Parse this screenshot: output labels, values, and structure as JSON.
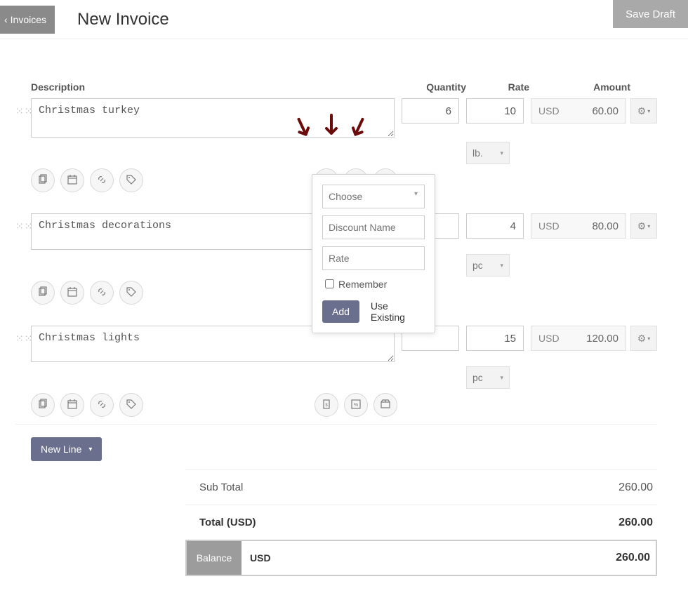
{
  "header": {
    "back_label": "Invoices",
    "title": "New Invoice",
    "save_draft_label": "Save Draft"
  },
  "columns": {
    "description": "Description",
    "quantity": "Quantity",
    "rate": "Rate",
    "amount": "Amount"
  },
  "lines": [
    {
      "description": "Christmas turkey",
      "quantity": "6",
      "rate": "10",
      "unit": "lb.",
      "currency": "USD",
      "amount": "60.00"
    },
    {
      "description": "Christmas decorations",
      "quantity": "",
      "rate": "4",
      "unit": "pc",
      "currency": "USD",
      "amount": "80.00"
    },
    {
      "description": "Christmas lights",
      "quantity": "",
      "rate": "15",
      "unit": "pc",
      "currency": "USD",
      "amount": "120.00"
    }
  ],
  "new_line_label": "New Line",
  "totals": {
    "subtotal_label": "Sub Total",
    "subtotal_value": "260.00",
    "total_label": "Total (USD)",
    "total_value": "260.00",
    "balance_label": "Balance",
    "balance_currency": "USD",
    "balance_value": "260.00"
  },
  "discount_popover": {
    "choose_placeholder": "Choose",
    "name_placeholder": "Discount Name",
    "rate_placeholder": "Rate",
    "remember_label": "Remember",
    "add_label": "Add",
    "use_existing_label": "Use Existing"
  }
}
